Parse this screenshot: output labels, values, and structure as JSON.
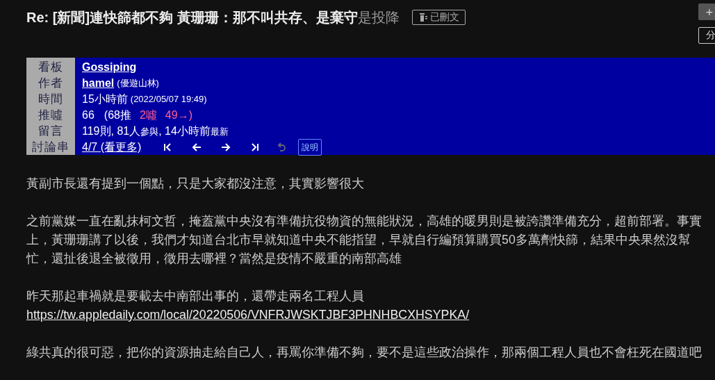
{
  "title": {
    "text": "Re: [新聞]連快篩都不夠 黃珊珊：那不叫共存、是棄守",
    "tail": "是投降",
    "badge": "已刪文"
  },
  "side_buttons": [
    "+",
    "分"
  ],
  "meta": [
    {
      "label": "看板",
      "kind": "link",
      "value": "Gossiping"
    },
    {
      "label": "作者",
      "kind": "author",
      "value": "hamel",
      "note": "(優遊山林)"
    },
    {
      "label": "時間",
      "kind": "text",
      "value": "15小時前",
      "note": "(2022/05/07 19:49)"
    },
    {
      "label": "推噓",
      "kind": "push",
      "score": "66",
      "push": "(68推",
      "boo": "2噓",
      "arrow": "49→)"
    },
    {
      "label": "留言",
      "kind": "parts",
      "parts": [
        {
          "text": "119則, 81人",
          "small": false
        },
        {
          "text": "參與",
          "small": true
        },
        {
          "text": ", 14小時前",
          "small": false
        },
        {
          "text": "最新",
          "small": true
        }
      ]
    },
    {
      "label": "討論串",
      "kind": "thread",
      "value": "4/7 (看更多)",
      "help": "說明",
      "undo_disabled": true
    }
  ],
  "body": [
    {
      "kind": "text",
      "text": "黃副市長還有提到一個點，只是大家都沒注意，其實影響很大"
    },
    {
      "kind": "text",
      "text": "之前黨媒一直在亂抹柯文哲，掩蓋黨中央沒有準備抗役物資的無能狀況，高雄的暖男則是被誇讚準備充分，超前部署。事實上，黃珊珊講了以後，我們才知道台北市早就知道中央不能指望，早就自行編預算購買50多萬劑快篩，結果中央果然沒幫忙，還扯後退全被徵用，徵用去哪裡？當然是疫情不嚴重的南部高雄"
    },
    {
      "kind": "text",
      "text": "昨天那起車禍就是要載去中南部出事的，還帶走兩名工程人員",
      "link": "https://tw.appledaily.com/local/20220506/VNFRJWSKTJBF3PHNHBCXHSYPKA/"
    },
    {
      "kind": "text",
      "text": "綠共真的很可惡，把你的資源抽走給自己人，再罵你準備不夠，要不是這些政治操作，那兩個工程人員也不會枉死在國道吧"
    }
  ]
}
